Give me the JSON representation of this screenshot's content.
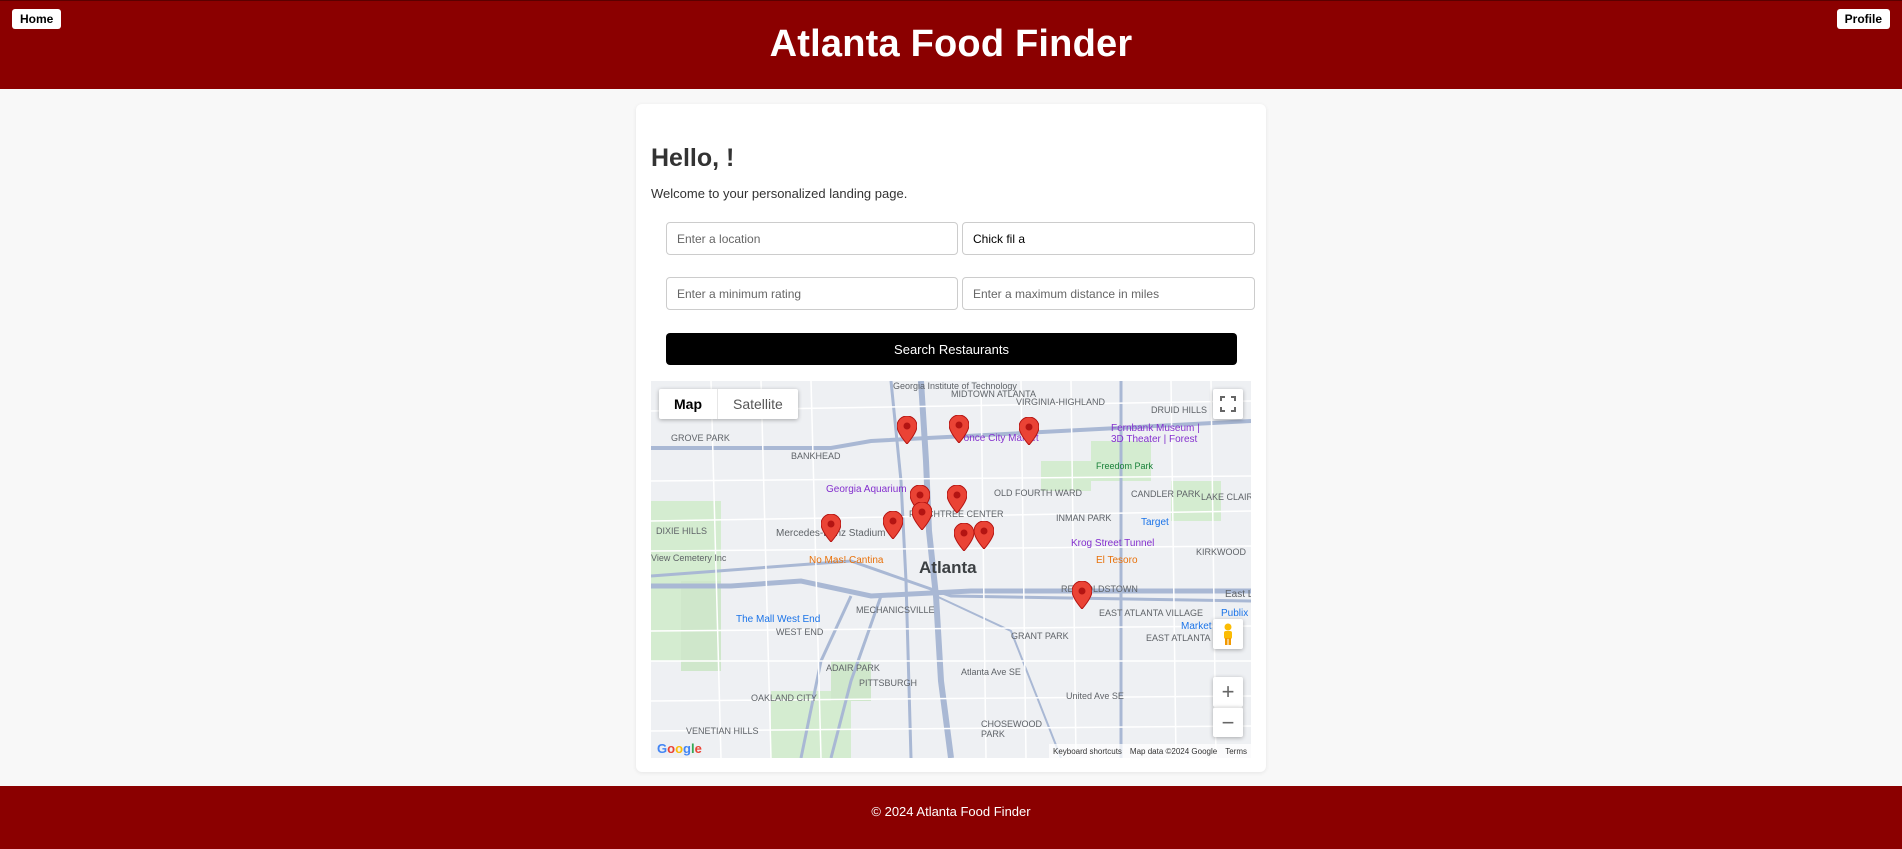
{
  "header": {
    "title": "Atlanta Food Finder",
    "home_label": "Home",
    "profile_label": "Profile"
  },
  "main": {
    "greeting": "Hello, !",
    "welcome": "Welcome to your personalized landing page.",
    "location_placeholder": "Enter a location",
    "food_value": "Chick fil a",
    "rating_placeholder": "Enter a minimum rating",
    "distance_placeholder": "Enter a maximum distance in miles",
    "search_label": "Search Restaurants"
  },
  "map": {
    "type_map": "Map",
    "type_satellite": "Satellite",
    "city_label": "Atlanta",
    "labels": {
      "georgia_tech": "Georgia Institute of Technology",
      "midtown": "MIDTOWN ATLANTA",
      "virginia_highland": "VIRGINIA-HIGHLAND",
      "druid_hills": "DRUID HILLS",
      "grove_park": "GROVE PARK",
      "bankhead": "BANKHEAD",
      "ponce": "Ponce City Market",
      "fernbank": "Fernbank Museum | 3D Theater | Forest",
      "freedom_park": "Freedom Park",
      "candler_park": "CANDLER PARK",
      "lake_claire": "LAKE CLAIRE",
      "aquarium": "Georgia Aquarium",
      "old_fourth_ward": "OLD FOURTH WARD",
      "inman_park": "INMAN PARK",
      "target": "Target",
      "peachtree_center": "PEACHTREE CENTER",
      "mercedes": "Mercedes-Benz Stadium",
      "dixie_hills": "DIXIE HILLS",
      "krog": "Krog Street Tunnel",
      "kirkwood": "KIRKWOOD",
      "el_tesoro": "El Tesoro",
      "no_mas": "No Mas! Cantina",
      "cemetery": "View Cemetery Inc",
      "reynoldstown": "REYNOLDSTOWN",
      "east_lake": "East Lake",
      "mechanicsville": "MECHANICSVILLE",
      "mall_west_end": "The Mall West End",
      "west_end": "WEST END",
      "east_atlanta_village": "EAST ATLANTA VILLAGE",
      "east_atlanta": "EAST ATLANTA",
      "publix": "Publix Su",
      "market": "Market",
      "grant_park": "GRANT PARK",
      "adair_park": "ADAIR PARK",
      "pittsburgh": "PITTSBURGH",
      "oakland_city": "OAKLAND CITY",
      "chosewood_park": "CHOSEWOOD PARK",
      "venetian_hills": "VENETIAN HILLS",
      "atlanta_ave": "Atlanta Ave SE",
      "united_ave": "United Ave SE"
    },
    "attribution": {
      "shortcuts": "Keyboard shortcuts",
      "data": "Map data ©2024 Google",
      "terms": "Terms"
    },
    "logo": "Google"
  },
  "footer": {
    "copyright": "© 2024 Atlanta Food Finder"
  }
}
